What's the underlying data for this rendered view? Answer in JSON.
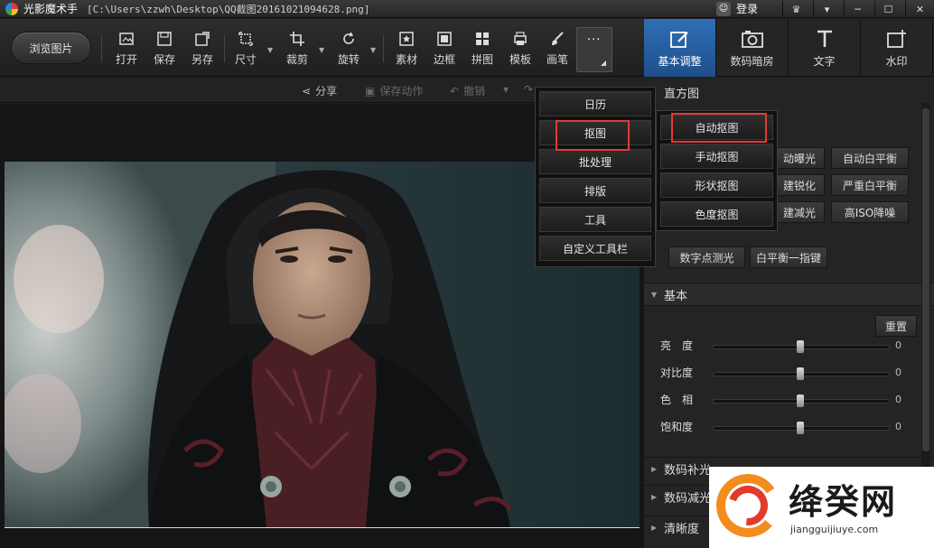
{
  "window": {
    "app_name": "光影魔术手",
    "file_path": "[C:\\Users\\zzwh\\Desktop\\QQ截图20161021094628.png]",
    "login_label": "登录"
  },
  "toolbar": {
    "browse_label": "浏览图片",
    "tools": [
      {
        "label": "打开",
        "icon": "open-icon"
      },
      {
        "label": "保存",
        "icon": "save-icon"
      },
      {
        "label": "另存",
        "icon": "save-as-icon"
      },
      {
        "label": "尺寸",
        "icon": "resize-icon"
      },
      {
        "label": "裁剪",
        "icon": "crop-icon"
      },
      {
        "label": "旋转",
        "icon": "rotate-icon"
      },
      {
        "label": "素材",
        "icon": "material-icon"
      },
      {
        "label": "边框",
        "icon": "border-icon"
      },
      {
        "label": "拼图",
        "icon": "collage-icon"
      },
      {
        "label": "模板",
        "icon": "template-icon"
      },
      {
        "label": "画笔",
        "icon": "brush-icon"
      }
    ],
    "more_label": "···"
  },
  "right_tabs": [
    {
      "label": "基本调整",
      "icon": "adjust-icon",
      "active": true
    },
    {
      "label": "数码暗房",
      "icon": "camera-icon",
      "active": false
    },
    {
      "label": "文字",
      "icon": "text-icon",
      "active": false
    },
    {
      "label": "水印",
      "icon": "watermark-icon",
      "active": false
    }
  ],
  "action_bar": {
    "share": "分享",
    "save_action": "保存动作",
    "undo": "撤销"
  },
  "more_menu": {
    "items": [
      "日历",
      "抠图",
      "批处理",
      "排版",
      "工具",
      "自定义工具栏"
    ],
    "highlighted": "抠图"
  },
  "cutout_submenu": {
    "items": [
      "自动抠图",
      "手动抠图",
      "形状抠图",
      "色度抠图"
    ],
    "highlighted": "自动抠图"
  },
  "right_panel": {
    "histogram_title": "直方图",
    "quick_buttons": [
      "动曝光",
      "自动白平衡",
      "建锐化",
      "严重白平衡",
      "建减光",
      "高ISO降噪"
    ],
    "metering_button": "数字点测光",
    "white_balance_button": "白平衡一指键",
    "basic_title": "基本",
    "reset_button": "重置",
    "sliders": [
      {
        "label": "亮　度",
        "value": 0
      },
      {
        "label": "对比度",
        "value": 0
      },
      {
        "label": "色　相",
        "value": 0
      },
      {
        "label": "饱和度",
        "value": 0
      }
    ],
    "sections": [
      "数码补光",
      "数码减光",
      "清晰度"
    ]
  },
  "watermark": {
    "title": "绛癸网",
    "url": "jiangguijiuye.com"
  },
  "colors": {
    "accent": "#2f6fb7",
    "highlight_border": "#e53935",
    "background": "#1e1e1e"
  }
}
